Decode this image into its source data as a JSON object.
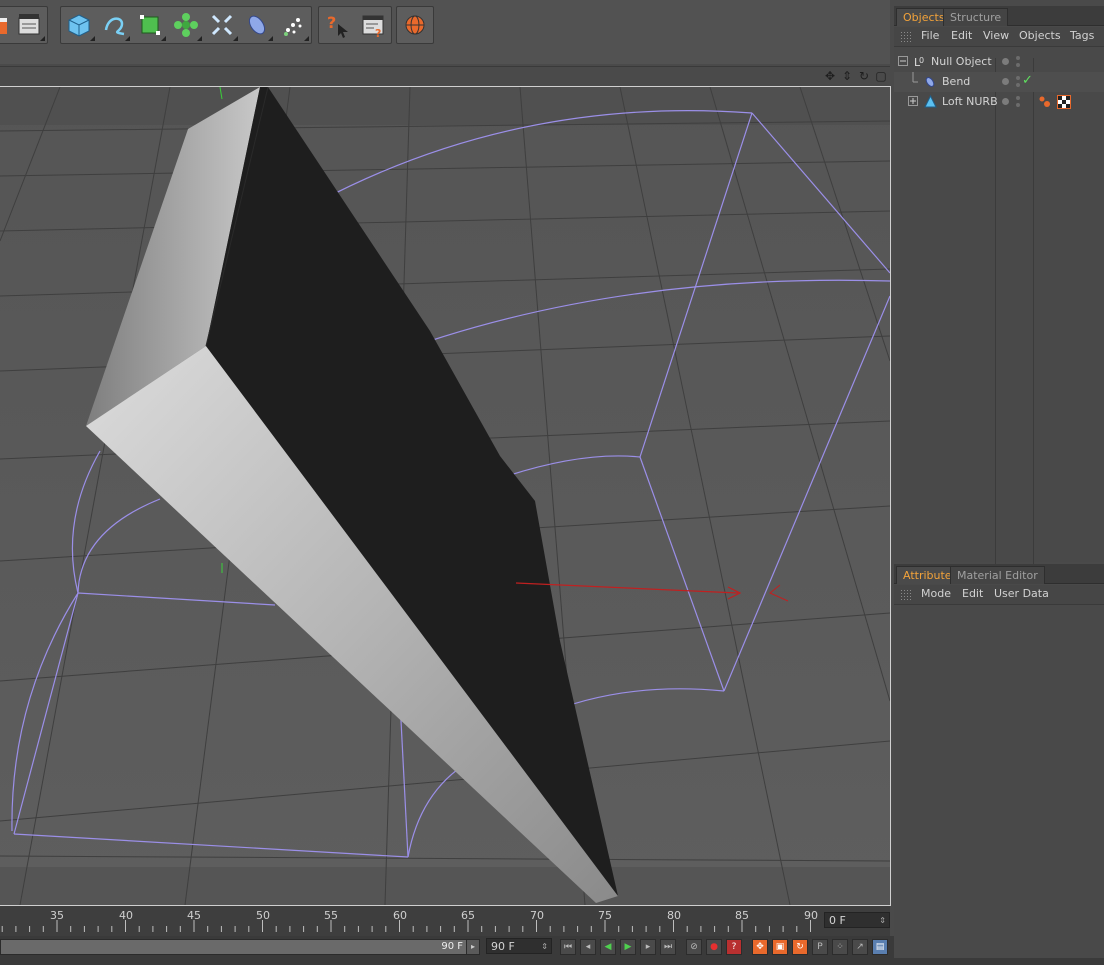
{
  "toolbar": {
    "groups": [
      {
        "buttons": [
          "render-clapper-icon",
          "edit-render-settings-icon"
        ]
      },
      {
        "buttons": [
          "cube-icon",
          "spline-pen-icon",
          "nurbs-icon",
          "array-icon",
          "scene-icon",
          "deformer-icon",
          "particle-icon"
        ]
      },
      {
        "buttons": [
          "help-cursor-icon",
          "timeline-icon"
        ]
      },
      {
        "buttons": [
          "globe-icon"
        ]
      }
    ]
  },
  "viewport": {
    "nav_icons": [
      "move-view-icon",
      "zoom-view-icon",
      "rotate-view-icon",
      "maximize-view-icon"
    ]
  },
  "objects_panel": {
    "tabs": [
      {
        "label": "Objects",
        "active": true
      },
      {
        "label": "Structure",
        "active": false
      }
    ],
    "menu": [
      "File",
      "Edit",
      "View",
      "Objects",
      "Tags"
    ],
    "items": [
      {
        "name": "Null Object",
        "indent": 0,
        "expander": "−",
        "icon": "null-object-icon",
        "check": ""
      },
      {
        "name": "Bend",
        "indent": 1,
        "expander": "",
        "icon": "bend-deformer-icon",
        "check": "✓"
      },
      {
        "name": "Loft NURB",
        "indent": 1,
        "expander": "+",
        "icon": "loft-nurbs-icon",
        "check": ""
      }
    ]
  },
  "attributes_panel": {
    "tabs": [
      {
        "label": "Attributes",
        "active": true
      },
      {
        "label": "Material Editor",
        "active": false
      }
    ],
    "menu": [
      "Mode",
      "Edit",
      "User Data"
    ]
  },
  "timeline": {
    "ticks": [
      "35",
      "40",
      "45",
      "50",
      "55",
      "60",
      "65",
      "70",
      "75",
      "80",
      "85",
      "90"
    ],
    "current_frame": "0 F",
    "range_end_label": "90 F",
    "end_frame_field": "90 F"
  },
  "colors": {
    "accent_tab": "#f3a33a",
    "wireframe": "#9b8fe8",
    "axis_red": "#c02020"
  }
}
